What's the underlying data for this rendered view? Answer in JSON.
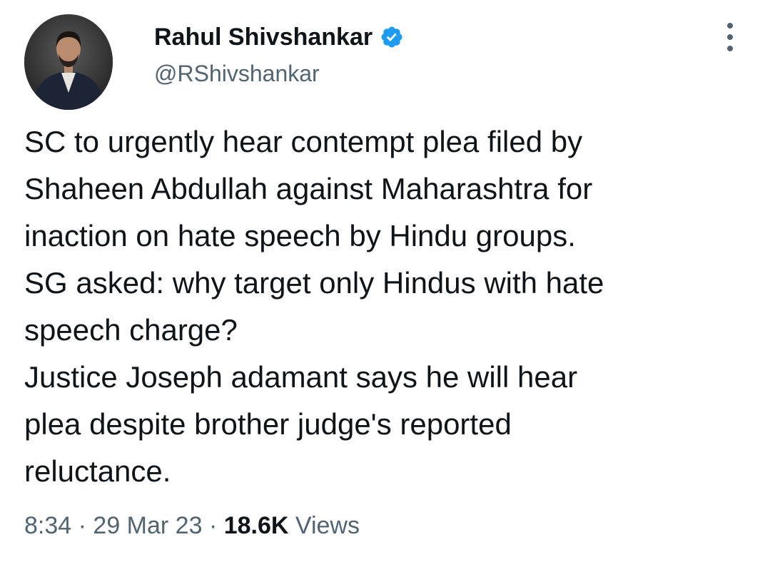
{
  "author": {
    "display_name": "Rahul Shivshankar",
    "handle": "@RShivshankar",
    "verified_icon": "verified-badge-icon",
    "badge_color": "#1d9bf0"
  },
  "tweet": {
    "lines": [
      "SC to urgently hear contempt plea filed by",
      "Shaheen Abdullah against Maharashtra for",
      "inaction on hate speech by Hindu groups.",
      "SG asked: why target only Hindus with hate",
      "speech charge?",
      "Justice Joseph adamant says he will hear",
      "plea despite brother judge's reported",
      "reluctance."
    ]
  },
  "meta": {
    "time": "8:34",
    "separator": " · ",
    "date": "29 Mar 23",
    "views_count": "18.6K",
    "views_label": "Views"
  },
  "more_icon": "more-options-icon"
}
